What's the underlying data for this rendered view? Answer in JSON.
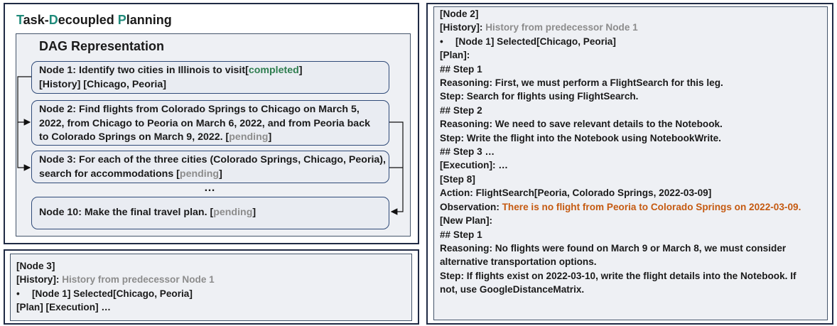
{
  "title": {
    "l1": "T",
    "r1": "ask-",
    "l2": "D",
    "r2": "ecoupled ",
    "l3": "P",
    "r3": "lanning"
  },
  "dag": {
    "heading": "DAG Representation",
    "node1": {
      "text": "Node 1: Identify two cities in Illinois to visit",
      "status": "completed",
      "line2": "[History] [Chicago, Peoria]"
    },
    "node2": {
      "l1": "Node 2: Find flights from Colorado Springs to Chicago on March 5,",
      "l2": "2022, from Chicago to Peoria on March 6, 2022, and from Peoria back",
      "l3": "to Colorado Springs on March 9, 2022. ",
      "status": "pending"
    },
    "node3": {
      "l1": "Node 3: For each of the three cities (Colorado Springs, Chicago, Peoria),",
      "l2": "search for accommodations ",
      "status": "pending"
    },
    "ellipsis": "…",
    "node10": {
      "text": "Node 10: Make the final travel plan. ",
      "status": "pending"
    }
  },
  "node3_panel": {
    "l1": "[Node 3]",
    "history_label": "[History]:",
    "history_text": " History from predecessor Node 1",
    "bullet": "•",
    "selected": "[Node 1] Selected[Chicago, Peoria]",
    "l4": "[Plan] [Execution] …"
  },
  "node2_panel": {
    "l1": "[Node 2]",
    "history_label": "[History]:",
    "history_text": " History from predecessor Node 1",
    "bullet": "•",
    "selected": "[Node 1] Selected[Chicago, Peoria]",
    "plan": "[Plan]:",
    "step1": "## Step 1",
    "r1": "Reasoning: First, we must perform a FlightSearch for this leg.",
    "s1": "Step: Search for flights using FlightSearch.",
    "step2": "## Step 2",
    "r2": "Reasoning: We need to save relevant details to the Notebook.",
    "s2": "Step: Write the flight into the Notebook using NotebookWrite.",
    "step3": "## Step 3 …",
    "exec": "[Execution]: …",
    "step8": "[Step 8]",
    "action": "Action: FlightSearch[Peoria, Colorado Springs, 2022-03-09]",
    "obs_label": "Observation: ",
    "obs_text": "There is no flight from Peoria to Colorado Springs on 2022-03-09.",
    "newplan": "[New Plan]:",
    "nstep1": "## Step 1",
    "nr1a": "Reasoning: No flights were found on March 9 or March 8, we must consider",
    "nr1b": "alternative transportation options.",
    "ns1a": "Step: If flights exist on 2022-03-10, write the flight details into the Notebook. If",
    "ns1b": "not, use GoogleDistanceMatrix."
  }
}
